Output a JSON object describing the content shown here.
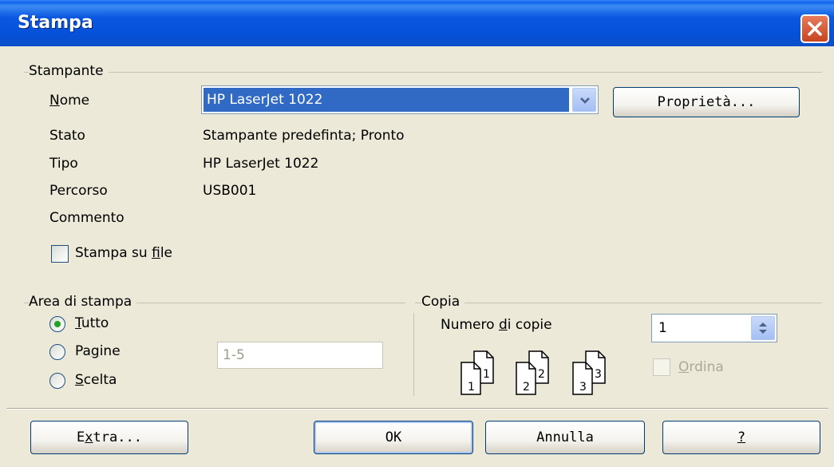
{
  "window": {
    "title": "Stampa"
  },
  "printer": {
    "group_label": "Stampante",
    "name_label": "Nome",
    "name_value": "HP LaserJet 1022",
    "properties_button": "Proprietà...",
    "status_label": "Stato",
    "status_value": "Stampante predefinta; Pronto",
    "type_label": "Tipo",
    "type_value": "HP LaserJet 1022",
    "path_label": "Percorso",
    "path_value": "USB001",
    "comment_label": "Commento",
    "comment_value": "",
    "print_to_file_label": "Stampa su file",
    "print_to_file_checked": false
  },
  "print_area": {
    "group_label": "Area di stampa",
    "options": [
      {
        "label": "Tutto",
        "selected": true
      },
      {
        "label": "Pagine",
        "selected": false
      },
      {
        "label": "Scelta",
        "selected": false
      }
    ],
    "pages_value": "1-5"
  },
  "copies": {
    "group_label": "Copia",
    "count_label": "Numero di copie",
    "count_value": "1",
    "collate_label": "Ordina",
    "collate_checked": false,
    "collate_enabled": false,
    "icons": [
      {
        "back": "1",
        "front": "1"
      },
      {
        "back": "2",
        "front": "2"
      },
      {
        "back": "3",
        "front": "3"
      }
    ]
  },
  "buttons": {
    "extra": "Extra...",
    "ok": "OK",
    "cancel": "Annulla",
    "help": "?"
  },
  "colors": {
    "titlebar": "#0651d9",
    "selection": "#316ac5",
    "dialog_bg": "#ece9d8",
    "close": "#c9431f"
  },
  "icons": [
    "close-icon",
    "chevron-down-icon",
    "spin-arrows-icon",
    "collate-pages-icon"
  ]
}
